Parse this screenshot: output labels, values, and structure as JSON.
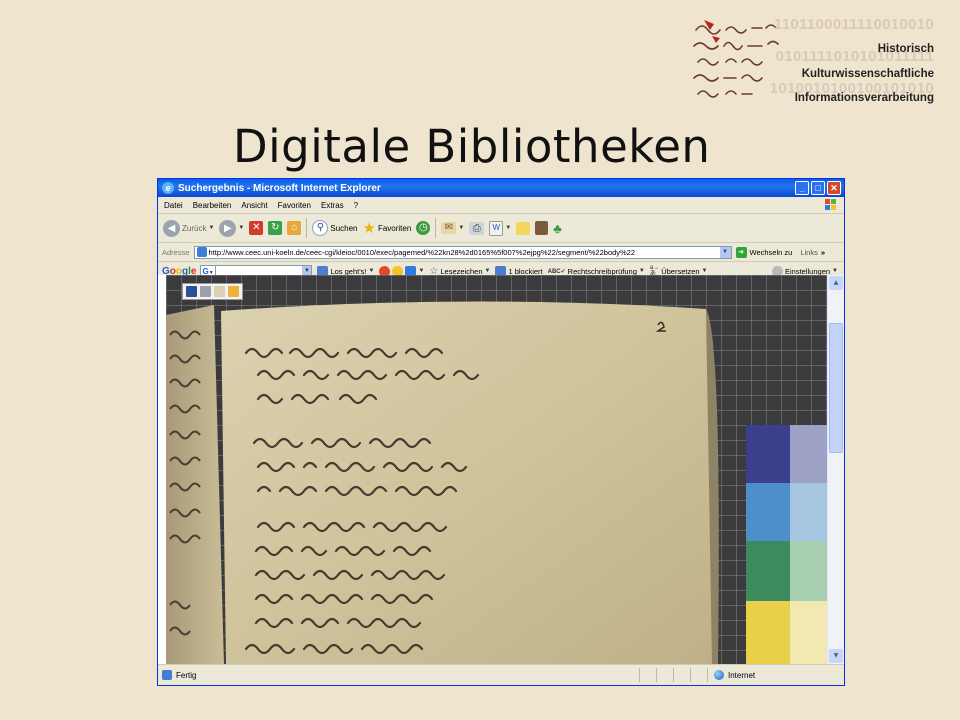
{
  "logo": {
    "binary": [
      "1101100011110010010",
      "0101111010101011111",
      "1010010100100101010"
    ],
    "lines": [
      "Historisch",
      "Kulturwissenschaftliche",
      "Informationsverarbeitung"
    ]
  },
  "slide": {
    "title": "Digitale Bibliotheken"
  },
  "window": {
    "title": "Suchergebnis - Microsoft Internet Explorer",
    "controls": [
      "_",
      "□",
      "✕"
    ]
  },
  "menu": [
    "Datei",
    "Bearbeiten",
    "Ansicht",
    "Favoriten",
    "Extras",
    "?"
  ],
  "toolbar": {
    "back": "Zurück",
    "search": "Suchen",
    "favorites": "Favoriten"
  },
  "address": {
    "label": "Adresse",
    "url": "http://www.ceec.uni-koeln.de/ceec-cgi/kleioc/0010/exec/pagemed/%22kn28%2d0165%5f007%2ejpg%22/segment/%22body%22",
    "go": "Wechseln zu",
    "links": "Links",
    "more": "»"
  },
  "google": {
    "logo": [
      "G",
      "o",
      "o",
      "g",
      "l",
      "e"
    ],
    "go": "Los geht's!",
    "bookmarks": "Lesezeichen",
    "blocked": "1 blockiert",
    "spell": "Rechtschreibprüfung",
    "translate": "Übersetzen",
    "settings": "Einstellungen"
  },
  "status": {
    "text": "Fertig",
    "zone": "Internet"
  },
  "colors": {
    "slide_bg": "#efe5cf",
    "xp_blue": "#0a5ef2",
    "parchment": "#d8cba3",
    "ink": "#3a2a25",
    "target_blue_dark": "#3c3f8c",
    "target_blue_light": "#4d8fc9",
    "target_green": "#3e8a5f",
    "target_yellow": "#e9d04a"
  }
}
